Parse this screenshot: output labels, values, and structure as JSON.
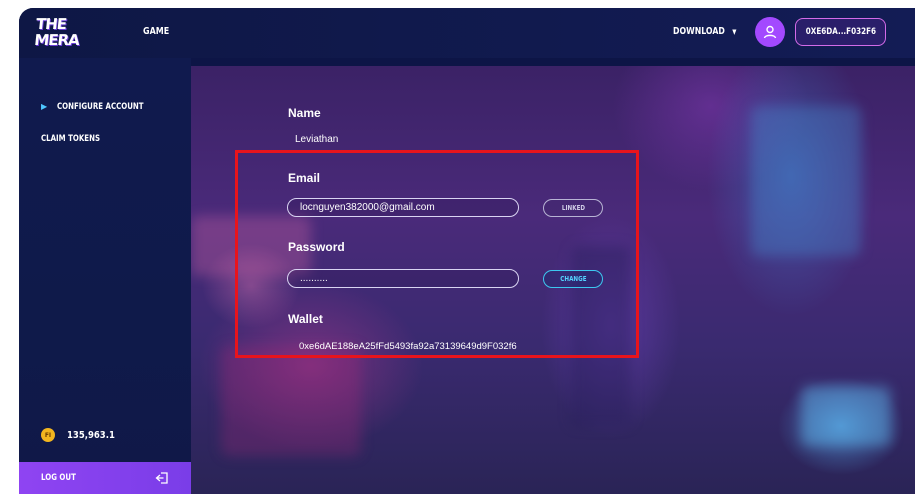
{
  "header": {
    "logo_line1": "THE",
    "logo_line2": "MERA",
    "nav_game": "GAME",
    "download_label": "DOWNLOAD",
    "download_caret": "▼",
    "wallet_short": "0XE6DA...F032F6"
  },
  "sidebar": {
    "items": [
      {
        "label": "CONFIGURE ACCOUNT",
        "active": true
      },
      {
        "label": "CLAIM TOKENS",
        "active": false
      }
    ],
    "balance": "135,963.1",
    "coin_label": "FI",
    "logout_label": "LOG OUT"
  },
  "form": {
    "name_label": "Name",
    "name_value": "Leviathan",
    "email_label": "Email",
    "email_value": "locnguyen382000@gmail.com",
    "email_button": "LINKED",
    "password_label": "Password",
    "password_value": "..........",
    "password_button": "CHANGE",
    "wallet_label": "Wallet",
    "wallet_value": "0xe6dAE188eA25fFd5493fa92a73139649d9F032f6"
  },
  "colors": {
    "accent_purple": "#a349ff",
    "highlight_red": "#e8141c",
    "change_blue": "#54d2ff"
  }
}
